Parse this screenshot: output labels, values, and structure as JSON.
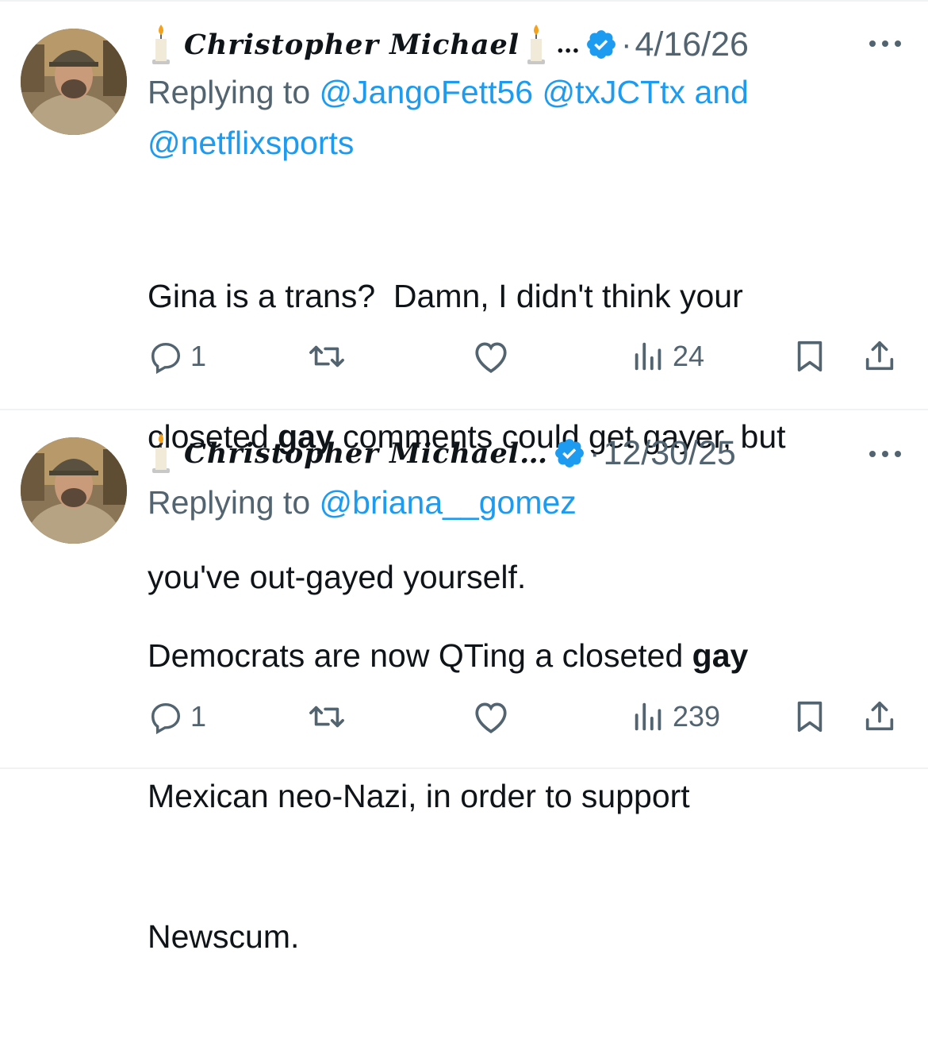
{
  "tweets": [
    {
      "author_name": "Christopher Michael",
      "author_suffix": "…",
      "date": "4/16/26",
      "replying_prefix": "Replying to",
      "replying_handles": "@JangoFett56 @txJCTtx",
      "replying_and": "and",
      "replying_handles_2": "@netflixsports",
      "body_lines": [
        {
          "pre": "Gina is a trans?  Damn, I didn't think your",
          "bold": "",
          "post": ""
        },
        {
          "pre": "closeted ",
          "bold": "gay",
          "post": " comments could get gayer, but"
        },
        {
          "pre": "you've out-gayed yourself.",
          "bold": "",
          "post": ""
        }
      ],
      "reply_count": "1",
      "retweet_count": "",
      "like_count": "",
      "view_count": "24"
    },
    {
      "author_name": "Christopher Michael…",
      "author_suffix": "",
      "date": "12/30/25",
      "replying_prefix": "Replying to",
      "replying_handles": "@briana__gomez",
      "replying_and": "",
      "replying_handles_2": "",
      "body_lines": [
        {
          "pre": "Democrats are now QTing a closeted ",
          "bold": "gay",
          "post": ""
        },
        {
          "pre": "Mexican neo-Nazi, in order to support",
          "bold": "",
          "post": ""
        },
        {
          "pre": "Newscum.",
          "bold": "",
          "post": ""
        }
      ],
      "reply_count": "1",
      "retweet_count": "",
      "like_count": "",
      "view_count": "239"
    }
  ],
  "icons": {
    "verified": "verified-badge-icon",
    "candle": "candle-emoji-icon",
    "reply": "reply-bubble-icon",
    "retweet": "retweet-icon",
    "like": "heart-icon",
    "views": "views-bar-chart-icon",
    "bookmark": "bookmark-icon",
    "share": "share-icon",
    "more": "more-dots-icon"
  },
  "colors": {
    "accent": "#1d9bf0",
    "muted": "#536471",
    "text": "#0f1419",
    "divider": "#eff3f4"
  }
}
